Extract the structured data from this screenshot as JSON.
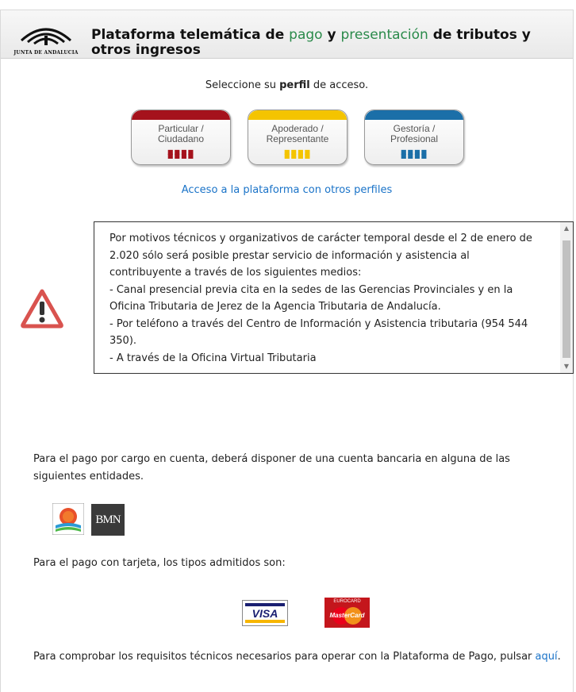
{
  "header": {
    "logo_text": "JUNTA DE ANDALUCIA",
    "title_part1": "Plataforma telemática de ",
    "title_hl1": "pago",
    "title_part2": " y ",
    "title_hl2": "presentación",
    "title_part3": " de tributos y otros ingresos"
  },
  "selector": {
    "prefix": "Seleccione su ",
    "bold": "perfil",
    "suffix": " de acceso."
  },
  "profiles": [
    {
      "line1": "Particular /",
      "line2": "Ciudadano",
      "color": "#a5121c"
    },
    {
      "line1": "Apoderado /",
      "line2": "Representante",
      "color": "#f4c400"
    },
    {
      "line1": "Gestoría /",
      "line2": "Profesional",
      "color": "#1b6fa8"
    }
  ],
  "other_profiles_link": "Acceso a la plataforma con otros perfiles",
  "notice": {
    "lines": [
      "Por motivos técnicos y organizativos de carácter temporal desde el 2 de enero de",
      "2.020 sólo será posible prestar servicio de información y asistencia al",
      "contribuyente a través de los siguientes medios:",
      "- Canal presencial previa cita en la sedes de las Gerencias Provinciales y en la",
      "Oficina Tributaria de Jerez de la Agencia Tributaria de Andalucía.",
      "- Por teléfono a través del Centro de Información y Asistencia tributaria (954 544",
      "350).",
      "- A través de la Oficina Virtual Tributaria"
    ]
  },
  "bank_text": "Para el pago por cargo en cuenta, deberá disponer de una cuenta bancaria en alguna de las siguientes entidades.",
  "bank_bmn": "BMN",
  "card_text": "Para el pago con tarjeta, los tipos admitidos son:",
  "card_visa": "VISA",
  "card_mc_top": "EUROCARD",
  "card_mc": "MasterCard",
  "requirements_text": "Para comprobar los requisitos técnicos necesarios para operar con la Plataforma de Pago, pulsar",
  "requirements_link": "aquí",
  "requirements_end": "."
}
